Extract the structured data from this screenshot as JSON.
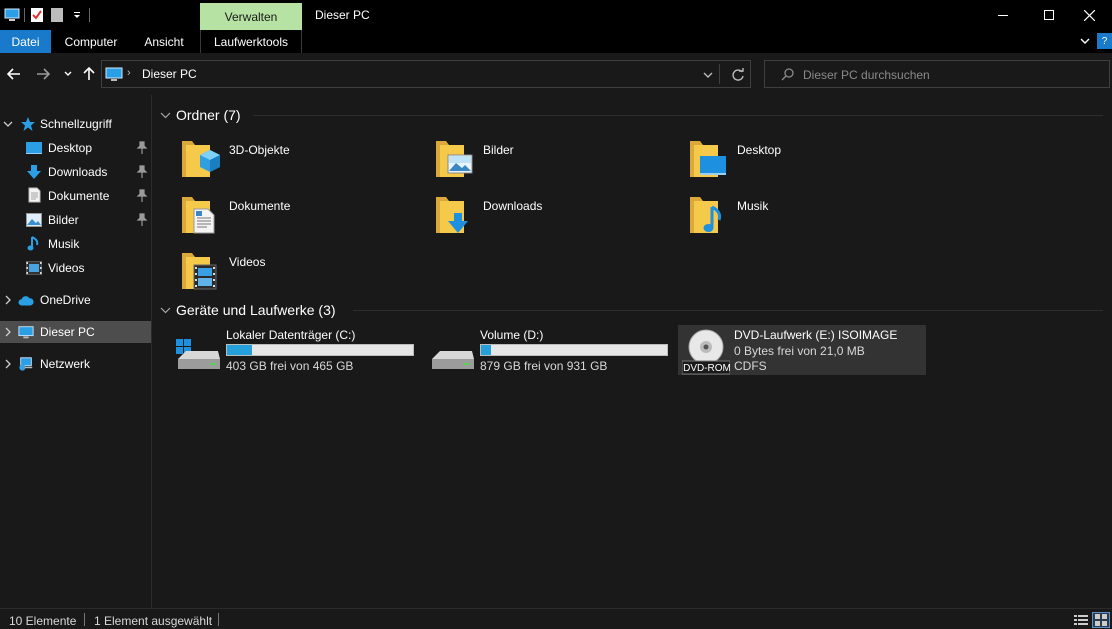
{
  "window": {
    "title": "Dieser PC",
    "context_tab_group": "Verwalten"
  },
  "ribbon": {
    "tabs": [
      {
        "label": "Datei"
      },
      {
        "label": "Computer"
      },
      {
        "label": "Ansicht"
      },
      {
        "label": "Laufwerktools"
      }
    ]
  },
  "address": {
    "crumb": "Dieser PC",
    "icon": "computer-icon"
  },
  "search": {
    "placeholder": "Dieser PC durchsuchen"
  },
  "sidebar": {
    "quick_access": {
      "label": "Schnellzugriff"
    },
    "items": [
      {
        "label": "Desktop",
        "icon": "desktop-icon",
        "pinned": true
      },
      {
        "label": "Downloads",
        "icon": "download-arrow-icon",
        "pinned": true
      },
      {
        "label": "Dokumente",
        "icon": "document-icon",
        "pinned": true
      },
      {
        "label": "Bilder",
        "icon": "picture-icon",
        "pinned": true
      },
      {
        "label": "Musik",
        "icon": "music-note-icon",
        "pinned": false
      },
      {
        "label": "Videos",
        "icon": "video-icon",
        "pinned": false
      }
    ],
    "onedrive": {
      "label": "OneDrive"
    },
    "this_pc": {
      "label": "Dieser PC",
      "selected": true
    },
    "network": {
      "label": "Netzwerk"
    }
  },
  "main": {
    "folders_header": "Ordner (7)",
    "folders": [
      {
        "label": "3D-Objekte",
        "icon": "3d-objects-folder-icon"
      },
      {
        "label": "Bilder",
        "icon": "pictures-folder-icon"
      },
      {
        "label": "Desktop",
        "icon": "desktop-folder-icon"
      },
      {
        "label": "Dokumente",
        "icon": "documents-folder-icon"
      },
      {
        "label": "Downloads",
        "icon": "downloads-folder-icon"
      },
      {
        "label": "Musik",
        "icon": "music-folder-icon"
      },
      {
        "label": "Videos",
        "icon": "videos-folder-icon"
      }
    ],
    "drives_header": "Geräte und Laufwerke (3)",
    "drives": [
      {
        "name": "Lokaler Datenträger (C:)",
        "info": "403 GB frei von 465 GB",
        "used_fraction": 0.133,
        "icon": "windows-drive-icon"
      },
      {
        "name": "Volume (D:)",
        "info": "879 GB frei von 931 GB",
        "used_fraction": 0.056,
        "icon": "hard-drive-icon"
      },
      {
        "name": "DVD-Laufwerk (E:) ISOIMAGE",
        "info": "0 Bytes frei von 21,0 MB",
        "fs": "CDFS",
        "icon": "dvd-drive-icon",
        "badge": "DVD-ROM",
        "selected": true
      }
    ]
  },
  "status": {
    "count": "10 Elemente",
    "selection": "1 Element ausgewählt"
  },
  "colors": {
    "accent": "#1979ca",
    "context_tab": "#b6e3a4",
    "progress": "#26a0da",
    "folder": "#f0c040"
  }
}
